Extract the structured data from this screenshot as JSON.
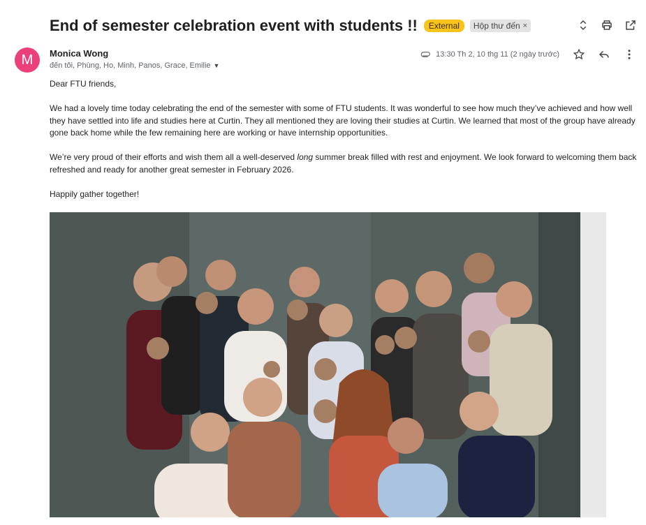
{
  "email": {
    "subject": "End of semester celebration event with students !!",
    "labels": {
      "external": "External",
      "inbox": "Hộp thư đến",
      "inbox_close": "×"
    },
    "sender": {
      "initial": "M",
      "name": "Monica Wong",
      "avatar_color": "#ec407a"
    },
    "recipients": "đến tôi, Phùng, Ho, Minh, Panos, Grace, Emilie",
    "date": "13:30 Th 2, 10 thg 11 (2 ngày trước)",
    "body": {
      "greeting": "Dear FTU friends,",
      "paragraph1": "We had a lovely time today celebrating the end of the semester with some of FTU students. It was wonderful to see how much they’ve achieved and how well they have settled into life and studies here at Curtin.  They all mentioned they are loving their studies at Curtin.  We learned that most of the group have already gone back home while the few remaining here are working or have internship opportunities.",
      "paragraph2_before": "We’re very proud of their efforts and wish them all a well-deserved ",
      "paragraph2_emphasis": "long",
      "paragraph2_after": " summer break filled with rest and enjoyment. We look forward to welcoming them back refreshed and ready for another great semester in February 2026.",
      "closing": "Happily gather together!"
    }
  },
  "icons": {
    "expand": "unfold-icon",
    "print": "print-icon",
    "open_new": "open-in-new-icon",
    "attachment": "paperclip-icon",
    "star": "star-icon",
    "reply": "reply-icon",
    "more": "more-vert-icon"
  },
  "colors": {
    "external_badge": "#f8c31b",
    "accent": "#ec407a"
  }
}
